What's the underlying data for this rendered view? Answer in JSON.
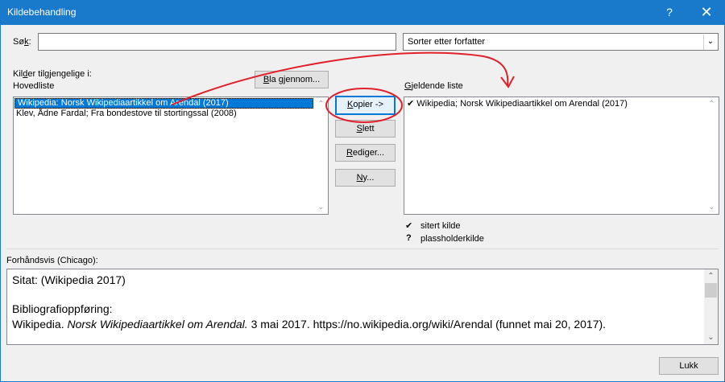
{
  "window": {
    "title": "Kildebehandling",
    "help_glyph": "?",
    "close_glyph": "✕"
  },
  "search": {
    "label_prefix": "Sø",
    "label_underlined": "k",
    "label_suffix": ":",
    "value": ""
  },
  "sort": {
    "selected": "Sorter etter forfatter",
    "arrow_glyph": "⌄"
  },
  "sources": {
    "label_line1_a": "Kil",
    "label_line1_u": "d",
    "label_line1_b": "er tilgjengelige i:",
    "label_line2": "Hovedliste",
    "browse_button_u": "B",
    "browse_button_rest": "la gjennom...",
    "items": [
      "Wikipedia: Norsk Wikipediaartikkel om Arendal (2017)",
      "Klev, Ådne Fardal; Fra bondestove til stortingssal (2008)"
    ]
  },
  "actions": {
    "copy_u": "K",
    "copy_rest": "opier ->",
    "delete_u": "S",
    "delete_rest": "lett",
    "edit_u": "R",
    "edit_rest": "ediger...",
    "new_u": "N",
    "new_rest": "y..."
  },
  "current": {
    "label_u": "G",
    "label_rest": "jeldende liste",
    "items": [
      {
        "mark": "✔",
        "text": "Wikipedia; Norsk Wikipediaartikkel om Arendal (2017)"
      }
    ],
    "legend": [
      {
        "mark": "✔",
        "text": "sitert kilde"
      },
      {
        "mark": "?",
        "text": "plassholderkilde"
      }
    ]
  },
  "preview": {
    "label": "Forhåndsvis (Chicago):",
    "citation": "Sitat:  (Wikipedia 2017)",
    "bib_heading": "Bibliografioppføring:",
    "bib_author": "Wikipedia. ",
    "bib_title": "Norsk Wikipediaartikkel om Arendal.",
    "bib_rest": " 3 mai 2017. https://no.wikipedia.org/wiki/Arendal (funnet mai 20, 2017)."
  },
  "footer": {
    "close_button": "Lukk"
  },
  "colors": {
    "titlebar": "#1979ca",
    "selection": "#0078d7",
    "annotation": "#e0202a"
  }
}
